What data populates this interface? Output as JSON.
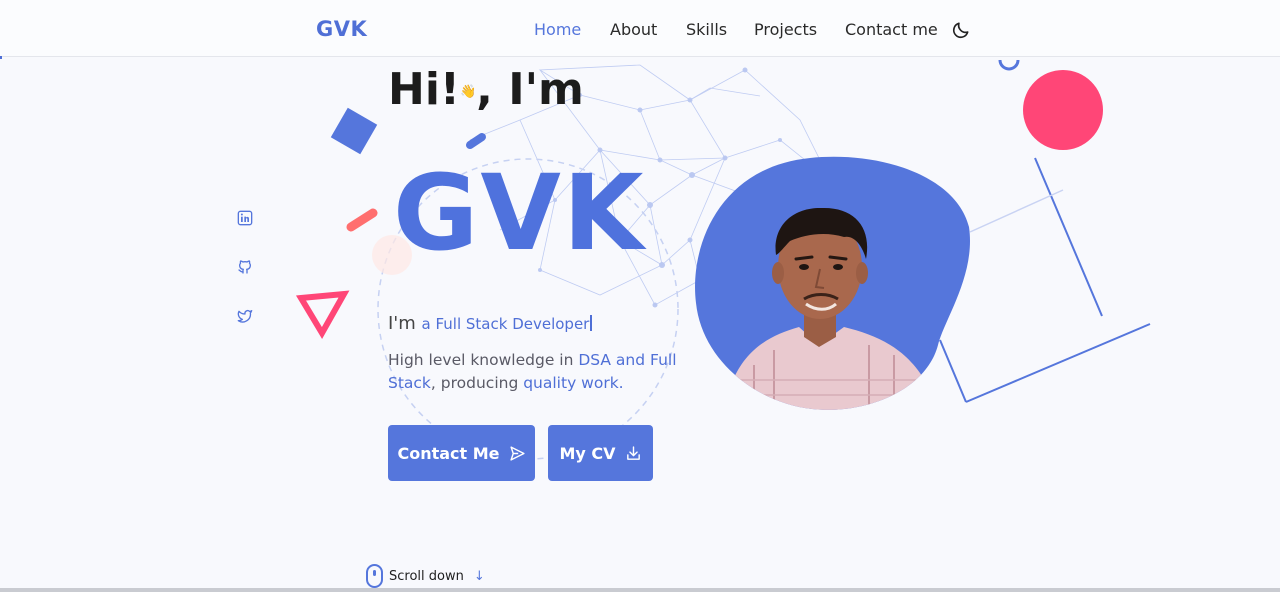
{
  "header": {
    "logo": "GVK",
    "nav": [
      {
        "label": "Home",
        "active": true
      },
      {
        "label": "About",
        "active": false
      },
      {
        "label": "Skills",
        "active": false
      },
      {
        "label": "Projects",
        "active": false
      },
      {
        "label": "Contact me",
        "active": false
      }
    ],
    "theme_toggle_icon": "moon-icon"
  },
  "hero": {
    "greeting_hi": "Hi!",
    "greeting_wave": "👋",
    "greeting_rest": ", I'm",
    "name": "GVK",
    "role_prefix": "I'm",
    "role_typed": "a Full Stack Developer",
    "desc_1": "High level knowledge in ",
    "desc_hl_1": "DSA and Full Stack",
    "desc_2": ", producing ",
    "desc_hl_2": "quality work."
  },
  "buttons": {
    "contact": {
      "label": "Contact Me",
      "icon": "send-icon"
    },
    "cv": {
      "label": "My CV",
      "icon": "download-icon"
    }
  },
  "social": [
    {
      "name": "linkedin",
      "icon": "linkedin-icon"
    },
    {
      "name": "github",
      "icon": "github-icon"
    },
    {
      "name": "twitter",
      "icon": "twitter-icon"
    }
  ],
  "scroll": {
    "label": "Scroll down",
    "icon": "arrow-down-icon"
  },
  "colors": {
    "accent": "#4f72dd",
    "pink": "#ff4677",
    "coral": "#ff6f6f",
    "background": "#f8f9fd"
  }
}
